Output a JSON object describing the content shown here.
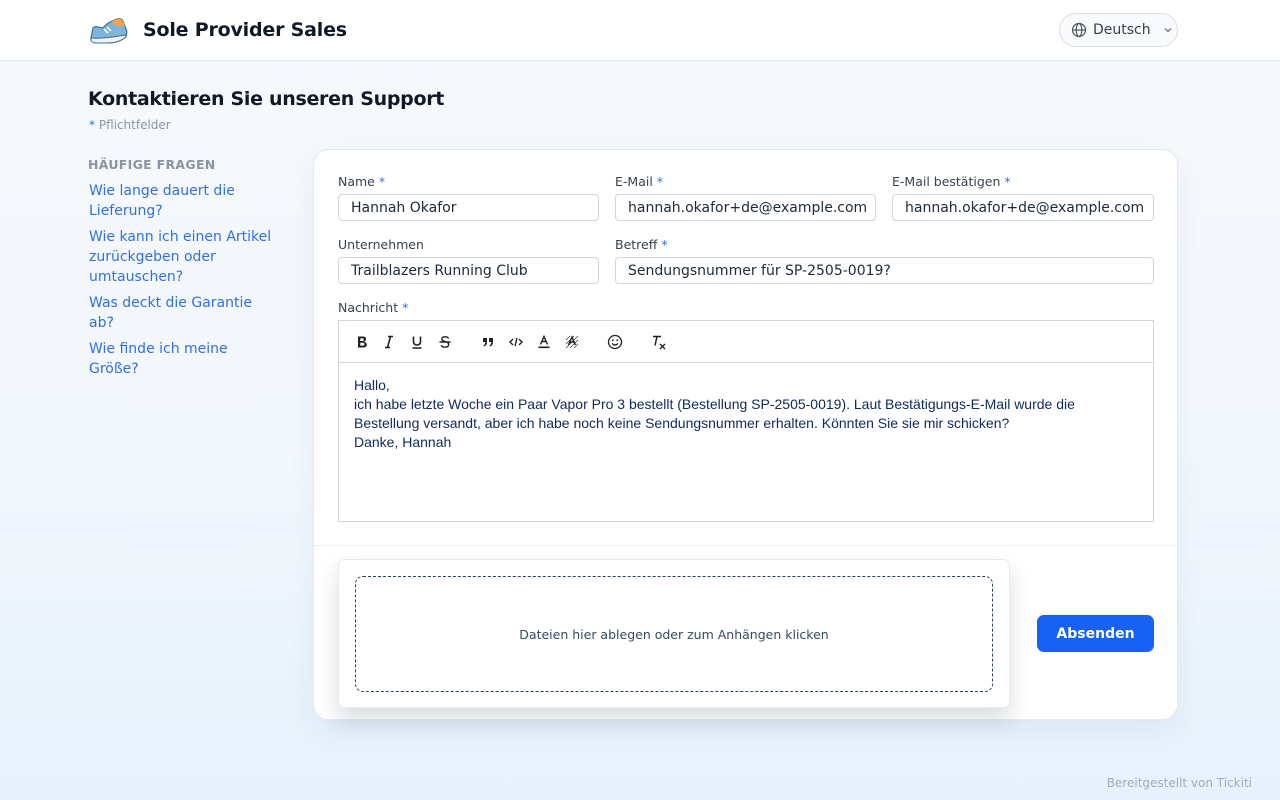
{
  "header": {
    "brand": "Sole Provider Sales",
    "language": "Deutsch",
    "icons": {
      "logo": "sneaker-logo",
      "language": "globe-icon",
      "dropdown": "chevron-down-icon"
    }
  },
  "page": {
    "title": "Kontaktieren Sie unseren Support",
    "required_note": "Pflichtfelder",
    "required_marker": "*"
  },
  "faq": {
    "title": "HÄUFIGE FRAGEN",
    "items": [
      "Wie lange dauert die Lieferung?",
      "Wie kann ich einen Artikel zurückgeben oder umtauschen?",
      "Was deckt die Garantie ab?",
      "Wie finde ich meine Größe?"
    ]
  },
  "form": {
    "name": {
      "label": "Name",
      "value": "Hannah Okafor"
    },
    "email": {
      "label": "E-Mail",
      "value": "hannah.okafor+de@example.com"
    },
    "email_confirm": {
      "label": "E-Mail bestätigen",
      "value": "hannah.okafor+de@example.com"
    },
    "company": {
      "label": "Unternehmen",
      "value": "Trailblazers Running Club"
    },
    "subject": {
      "label": "Betreff",
      "value": "Sendungsnummer für SP-2505-0019?"
    },
    "message": {
      "label": "Nachricht",
      "lines": [
        "Hallo,",
        "ich habe letzte Woche ein Paar Vapor Pro 3 bestellt (Bestellung SP-2505-0019). Laut Bestätigungs-E-Mail wurde die Bestellung versandt, aber ich habe noch keine Sendungsnummer erhalten. Könnten Sie sie mir schicken?",
        "Danke, Hannah"
      ]
    },
    "toolbar": [
      "bold-icon",
      "italic-icon",
      "underline-icon",
      "strikethrough-icon",
      "quote-icon",
      "code-icon",
      "text-color-icon",
      "highlight-icon",
      "emoji-icon",
      "clear-format-icon"
    ],
    "dropzone_text": "Dateien hier ablegen oder zum Anhängen klicken",
    "submit_label": "Absenden"
  },
  "footer": {
    "text": "Bereitgestellt von Tickiti"
  },
  "colors": {
    "accent": "#1762f2",
    "link": "#2f6fe8",
    "muted": "#8a94a3"
  }
}
